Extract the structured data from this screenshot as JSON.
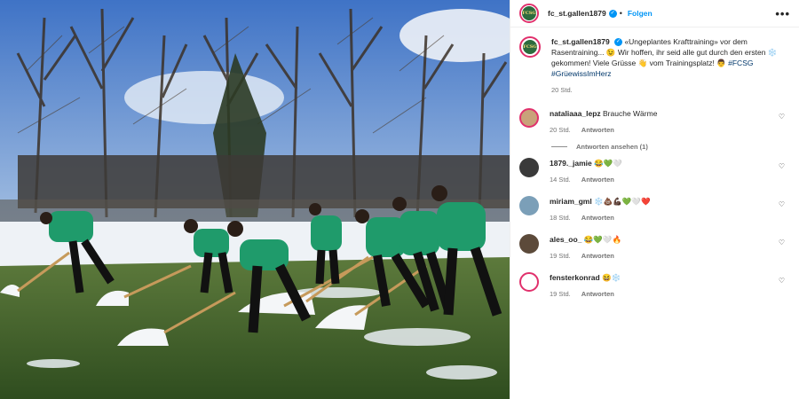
{
  "header": {
    "username": "fc_st.gallen1879",
    "follow_label": "Folgen",
    "dot": "•",
    "more_label": "•••",
    "avatar_text": "FCSG"
  },
  "caption": {
    "username": "fc_st.gallen1879",
    "text": "«Ungeplantes Krafttraining» vor dem Rasentraining... 😉 Wir hoffen, ihr seid alle gut durch den ersten ❄️ gekommen! Viele Grüsse 👋 vom Trainingsplatz! 👨",
    "hashtag1": "#FCSG",
    "hashtag2": "#GrüewissImHerz",
    "time": "20 Std."
  },
  "comments": [
    {
      "username": "nataliaaa_lepz",
      "text": "Brauche Wärme",
      "time": "20 Std.",
      "reply": "Antworten",
      "avatar_color": "#c9a27a"
    },
    {
      "username": "1879._jamie",
      "text": "😂💚🤍",
      "time": "14 Std.",
      "reply": "Antworten",
      "avatar_color": "#3a3a3a"
    },
    {
      "username": "miriam_gml",
      "text": "❄️💩💪🏿💚🤍❤️",
      "time": "18 Std.",
      "reply": "Antworten",
      "avatar_color": "#7b9fb8"
    },
    {
      "username": "ales_oo_",
      "text": "😂💚🤍🔥",
      "time": "19 Std.",
      "reply": "Antworten",
      "avatar_color": "#5c4a3a"
    },
    {
      "username": "fensterkonrad",
      "text": "😆❄️",
      "time": "19 Std.",
      "reply": "Antworten",
      "avatar_color": "#f2f2f2"
    }
  ],
  "view_replies": "Antworten ansehen (1)",
  "icons": {
    "heart": "heart-outline-icon",
    "verified": "verified-badge-icon",
    "more": "more-options-icon"
  },
  "colors": {
    "accent": "#0095f6",
    "club_green": "#2d6b3e",
    "jersey": "#1f9b6b"
  }
}
